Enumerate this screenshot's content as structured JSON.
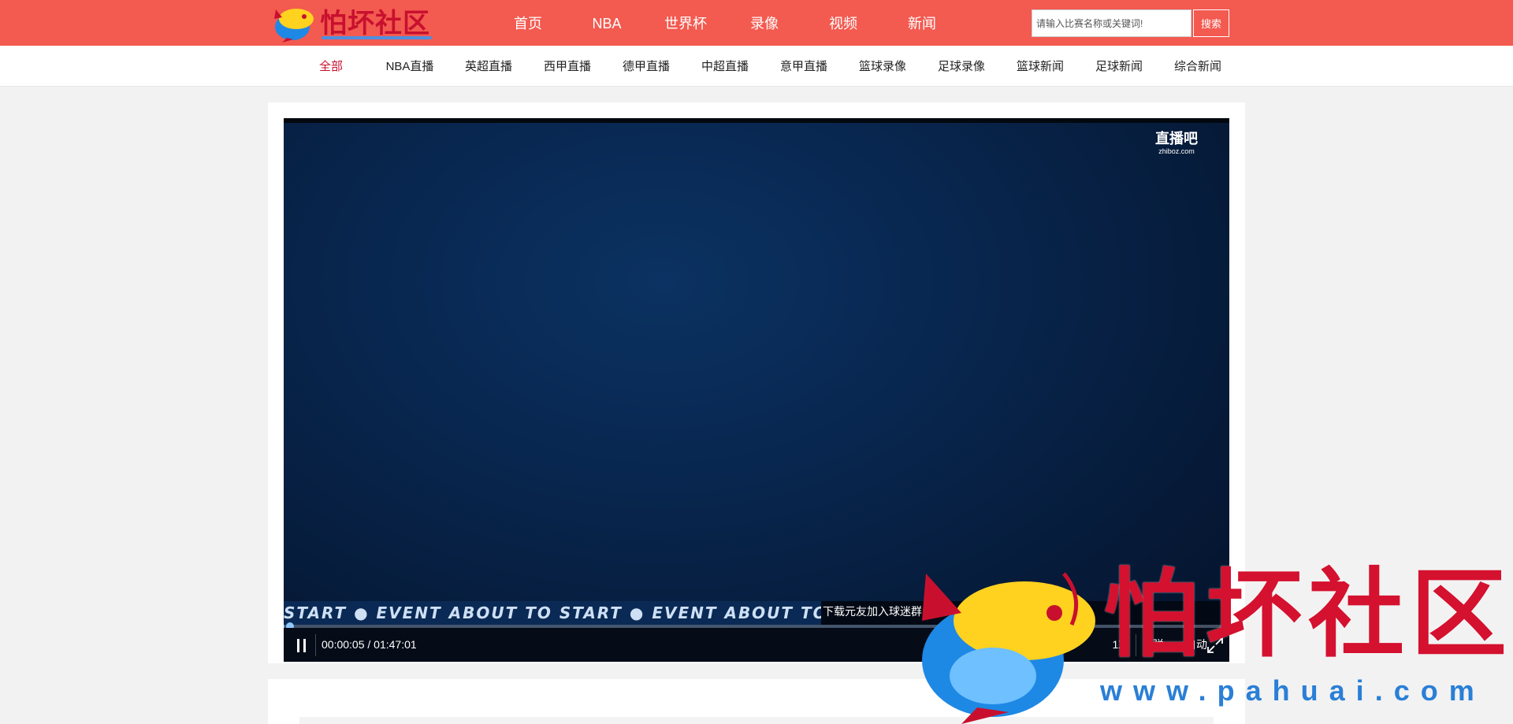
{
  "header": {
    "logo_text": "怕坏社区",
    "nav": [
      "首页",
      "NBA",
      "世界杯",
      "录像",
      "视频",
      "新闻"
    ],
    "search": {
      "placeholder": "请输入比赛名称或关键词!",
      "button_label": "搜索"
    }
  },
  "subnav": {
    "items": [
      "全部",
      "NBA直播",
      "英超直播",
      "西甲直播",
      "德甲直播",
      "中超直播",
      "意甲直播",
      "篮球录像",
      "足球录像",
      "篮球新闻",
      "足球新闻",
      "综合新闻"
    ],
    "active_index": 0
  },
  "player": {
    "watermark_main": "直播吧",
    "watermark_sub": "zhiboz.com",
    "ticker_text": "START  ●  EVENT ABOUT TO START  ●  EVENT ABOUT TO STAR",
    "marquee_text": "下载元友加入球迷群:",
    "time_display": "00:00:05 / 01:47:01",
    "progress_fraction": 0.0008,
    "speed_label": "1X",
    "bullet_label": "弹",
    "quality_label": "自动"
  },
  "overlay_watermark": {
    "text": "怕坏社区",
    "url": "www.pahuai.com"
  },
  "colors": {
    "header_bg": "#f35a50",
    "active_subnav": "#c8102e",
    "logo_red": "#c8102e",
    "player_bg": "#061630"
  }
}
